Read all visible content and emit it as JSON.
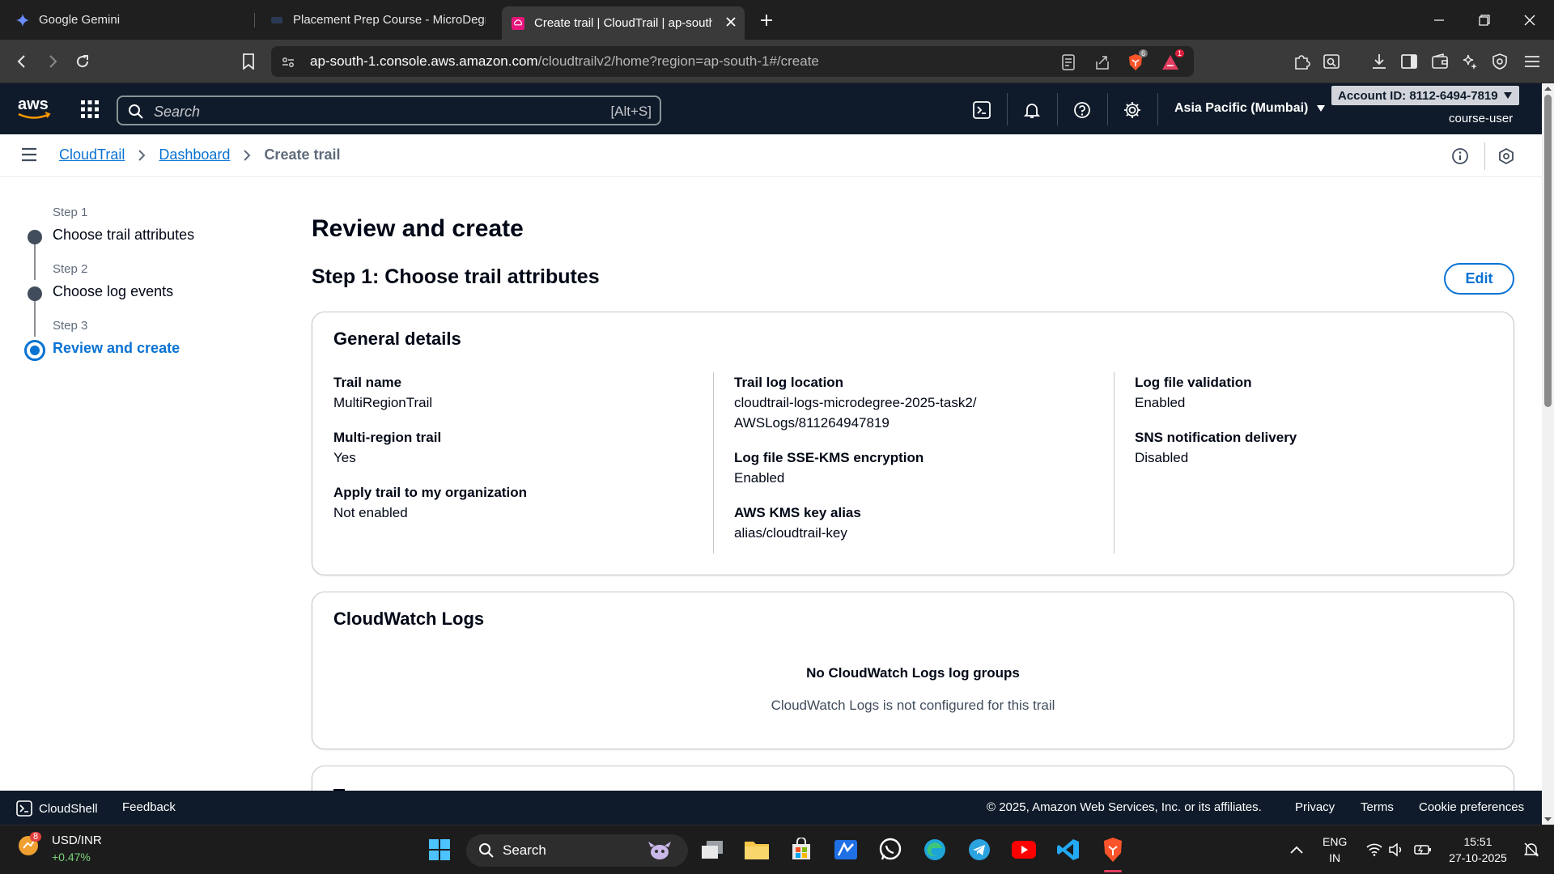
{
  "browser": {
    "tabs": [
      {
        "title": "Google Gemini",
        "active": false
      },
      {
        "title": "Placement Prep Course - MicroDegree",
        "active": false
      },
      {
        "title": "Create trail | CloudTrail | ap-south-1",
        "active": true
      }
    ],
    "url_host": "ap-south-1.console.aws.amazon.com",
    "url_path": "/cloudtrailv2/home?region=ap-south-1#/create",
    "brave_badge": "6",
    "alert_badge": "1"
  },
  "aws_nav": {
    "logo": "aws",
    "search_placeholder": "Search",
    "search_shortcut": "[Alt+S]",
    "region": "Asia Pacific (Mumbai)",
    "account": "Account ID: 8112-6494-7819",
    "user": "course-user"
  },
  "breadcrumb": {
    "items": [
      "CloudTrail",
      "Dashboard"
    ],
    "current": "Create trail"
  },
  "wizard": {
    "steps": [
      {
        "label": "Step 1",
        "name": "Choose trail attributes"
      },
      {
        "label": "Step 2",
        "name": "Choose log events"
      },
      {
        "label": "Step 3",
        "name": "Review and create"
      }
    ]
  },
  "main": {
    "title": "Review and create",
    "section_title": "Step 1: Choose trail attributes",
    "edit_label": "Edit",
    "general": {
      "title": "General details",
      "col1": [
        {
          "key": "Trail name",
          "value": "MultiRegionTrail"
        },
        {
          "key": "Multi-region trail",
          "value": "Yes"
        },
        {
          "key": "Apply trail to my organization",
          "value": "Not enabled"
        }
      ],
      "col2": [
        {
          "key": "Trail log location",
          "value": "cloudtrail-logs-microdegree-2025-task2/AWSLogs/811264947819"
        },
        {
          "key": "Log file SSE-KMS encryption",
          "value": "Enabled"
        },
        {
          "key": "AWS KMS key alias",
          "value": "alias/cloudtrail-key"
        }
      ],
      "col3": [
        {
          "key": "Log file validation",
          "value": "Enabled"
        },
        {
          "key": "SNS notification delivery",
          "value": "Disabled"
        }
      ]
    },
    "cloudwatch": {
      "title": "CloudWatch Logs",
      "empty_title": "No CloudWatch Logs log groups",
      "empty_sub": "CloudWatch Logs is not configured for this trail"
    }
  },
  "footer": {
    "cloudshell": "CloudShell",
    "feedback": "Feedback",
    "copyright": "© 2025, Amazon Web Services, Inc. or its affiliates.",
    "privacy": "Privacy",
    "terms": "Terms",
    "cookies": "Cookie preferences"
  },
  "taskbar": {
    "stock_name": "USD/INR",
    "stock_change": "+0.47%",
    "stock_badge": "8",
    "search": "Search",
    "lang1": "ENG",
    "lang2": "IN",
    "time": "15:51",
    "date": "27-10-2025"
  },
  "colors": {
    "aws_nav": "#0f1b2a",
    "link": "#0972d3",
    "chrome": "#1f1f1f"
  }
}
